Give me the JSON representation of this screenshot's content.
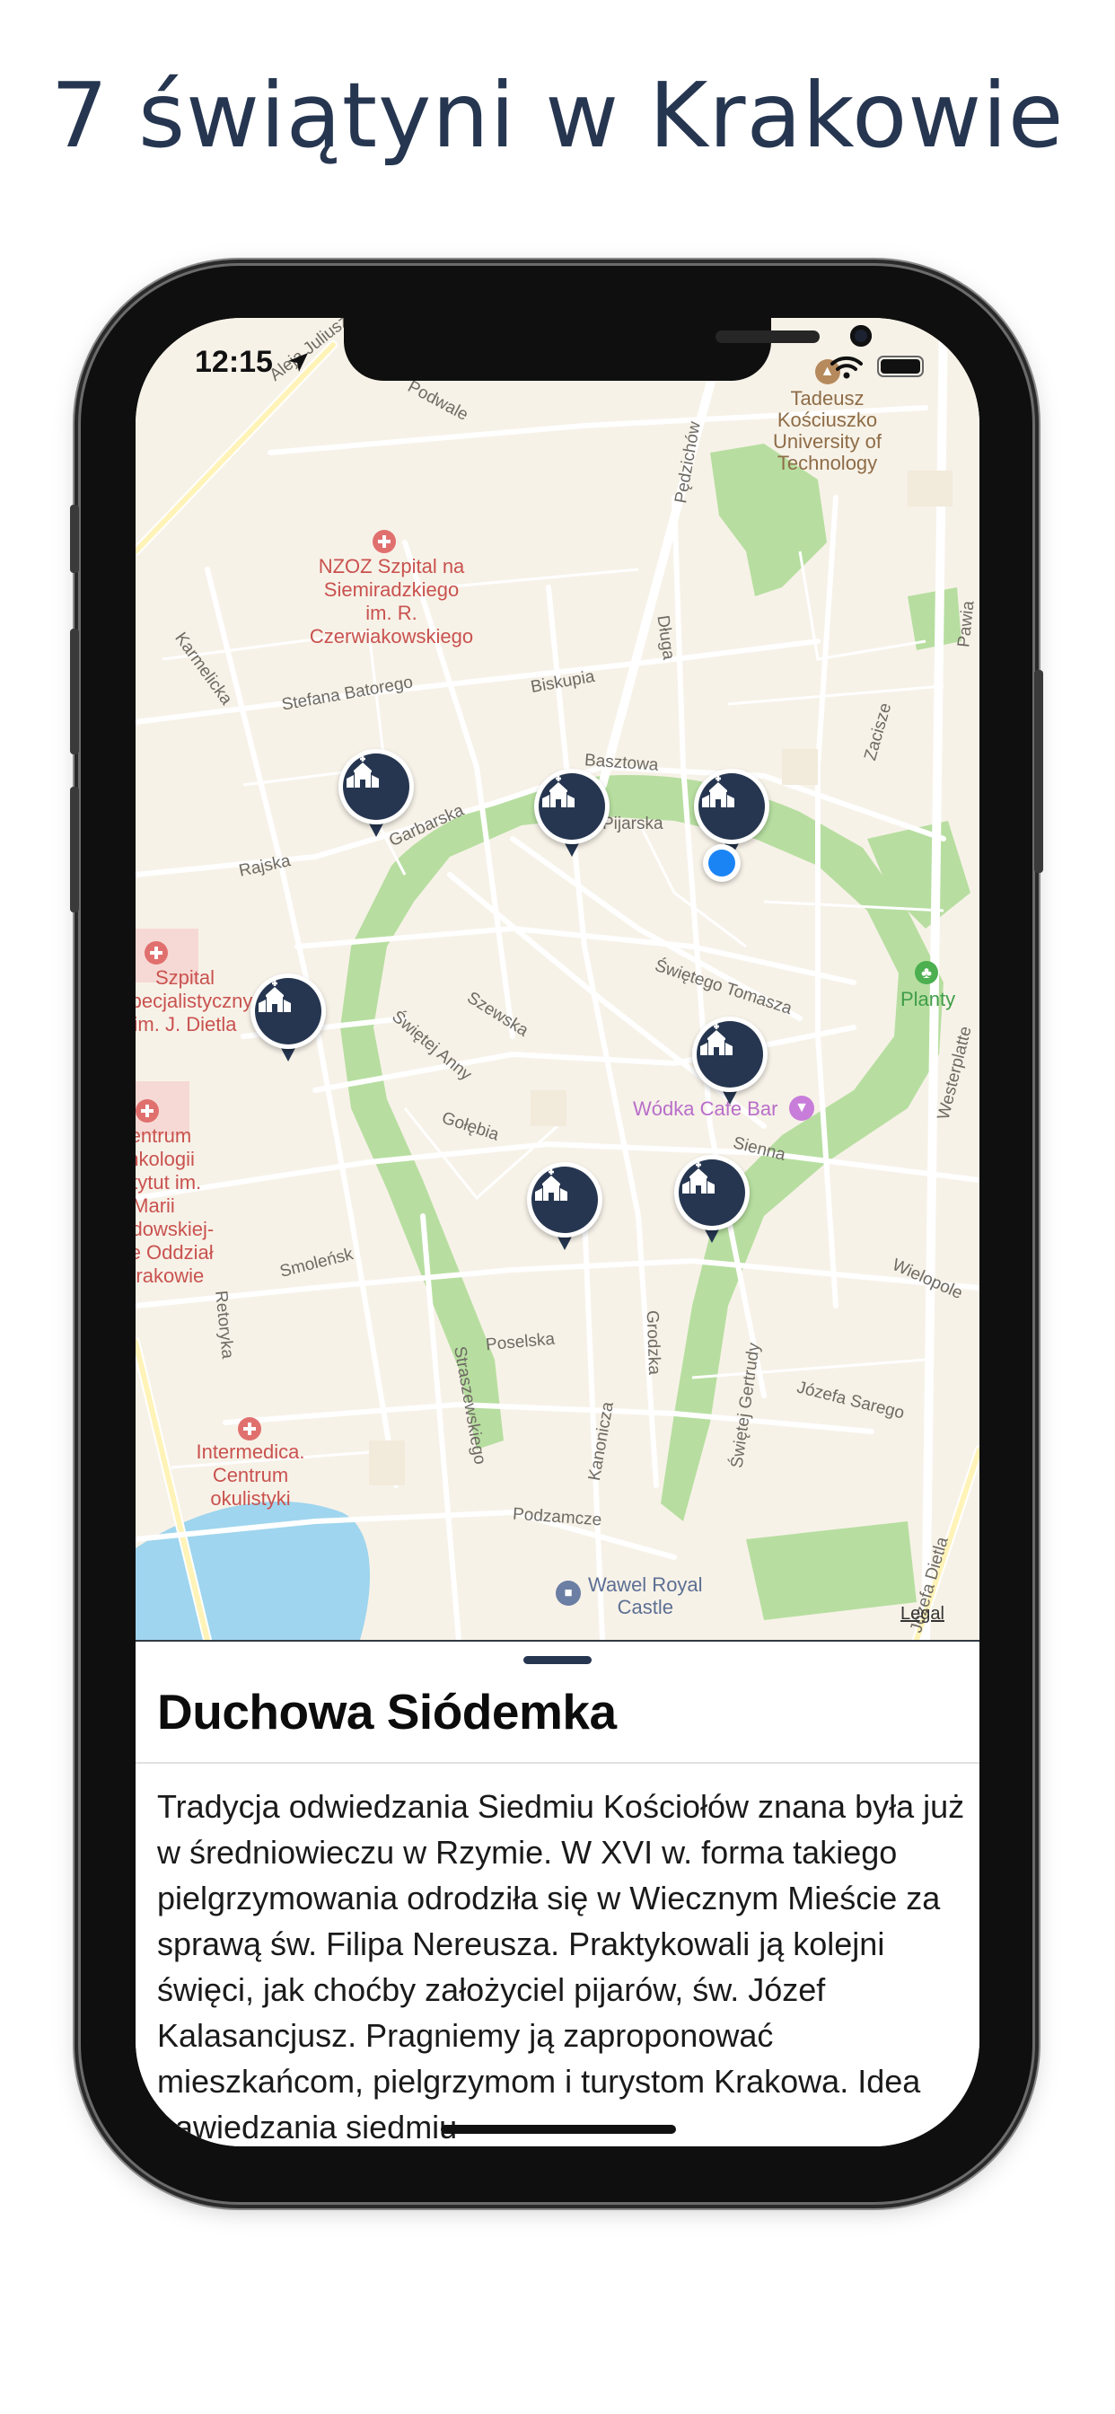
{
  "headline": "7 świątyni w Krakowie",
  "status_bar": {
    "time": "12:15"
  },
  "map": {
    "streets": [
      "Aleja Juliusza",
      "Podwale",
      "Karmelicka",
      "Stefana Batorego",
      "Biskupia",
      "Długa",
      "Pędzichów",
      "Basztowa",
      "Pijarska",
      "Garbarska",
      "Rajska",
      "Szewska",
      "Świętej Anny",
      "Świętego Tomasza",
      "Gołębia",
      "Sienna",
      "Smoleńsk",
      "Retoryka",
      "Poselska",
      "Grodzka",
      "Straszewskiego",
      "Kanonicza",
      "Świętej Gertrudy",
      "Podzamcze",
      "Józefa Sarego",
      "Wielopole",
      "Westerplatte",
      "Zacisze",
      "Pawia",
      "Józefa Dietla"
    ],
    "pois": {
      "tadeusz": "Tadeusz\nKościuszko\nUniversity of\nTechnology",
      "nzoz": "NZOZ Szpital na\nSiemiradzkiego\nim. R.\nCzerwiakowskiego",
      "szpital_dietla": "Szpital\nSpecjalistyczny\nim. J. Dietla",
      "centrum": "Centrum\nOnkologii\nInstytut im.\nMarii\nSkłodowskiej-\nCurie Oddział\nw Krakowie",
      "intermedica": "Intermedica.\nCentrum\nokulistyki",
      "planty": "Planty",
      "wodka": "Wódka Cafe Bar",
      "wawel": "Wawel Royal\nCastle",
      "legal": "Legal"
    }
  },
  "pins_icon": "church-icon",
  "sheet": {
    "title": "Duchowa Siódemka",
    "body": "Tradycja odwiedzania Siedmiu Kościołów znana była już w średniowieczu w Rzymie. W XVI w. forma takiego pielgrzymowania odrodziła się w Wiecznym Mieście za sprawą św. Filipa Nereusza. Praktykowali ją kolejni święci, jak choćby założyciel pijarów, św. Józef Kalasancjusz. Pragniemy ją zaproponować mieszkańcom, pielgrzymom i turystom Krakowa. Idea nawiedzania siedmiu"
  },
  "colors": {
    "navy": "#263650",
    "user_location": "#1a84f5",
    "park": "#b7dea0",
    "water": "#9fd5ee"
  }
}
